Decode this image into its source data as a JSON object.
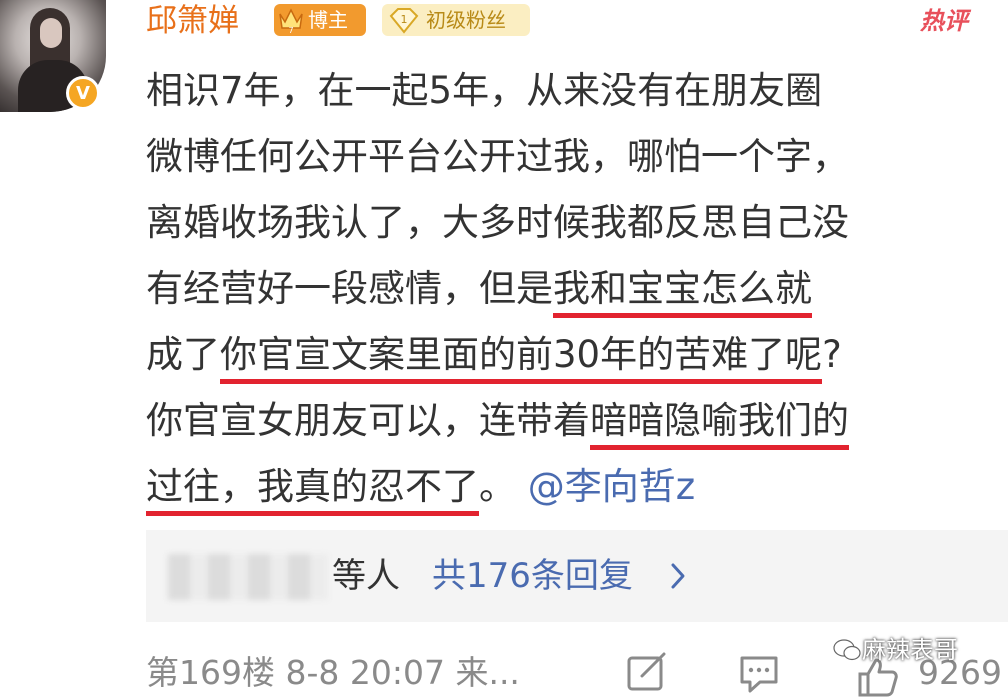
{
  "comment": {
    "username": "邱箫婵",
    "badge_level_icon": "crown-icon",
    "blogger_badge": "博主",
    "fan_badge_level": "1",
    "fan_badge": "初级粉丝",
    "verified_badge": "V",
    "hot_tag": "热评",
    "lines": [
      {
        "a": "相识7年，在一起5年，从来没有在朋友圈",
        "u": "",
        "b": ""
      },
      {
        "a": "微博任何公开平台公开过我，哪怕一个字，",
        "u": "",
        "b": ""
      },
      {
        "a": "离婚收场我认了，大多时候我都反思自己没",
        "u": "",
        "b": ""
      },
      {
        "a": "有经营好一段感情，但是",
        "u": "我和宝宝怎么就",
        "b": ""
      },
      {
        "a": "成了",
        "u": "你官宣文案里面的前30年的苦难了呢",
        "b": "?"
      },
      {
        "a": "你官宣女朋友可以，连带着",
        "u": "暗暗隐喻我们的",
        "b": ""
      },
      {
        "a": "",
        "u": "过往，我真的忍不了",
        "b": "。"
      }
    ],
    "mention": "@李向哲z"
  },
  "replies": {
    "suffix": "等人",
    "more_label": "共176条回复"
  },
  "footer": {
    "meta": "第169楼 8-8 20:07 来...",
    "watermark": "麻辣表哥",
    "like_count": "9269"
  },
  "colors": {
    "username": "#e8701a",
    "underline": "#e2232f",
    "link": "#4a6bb0",
    "hot": "#e8505b"
  }
}
